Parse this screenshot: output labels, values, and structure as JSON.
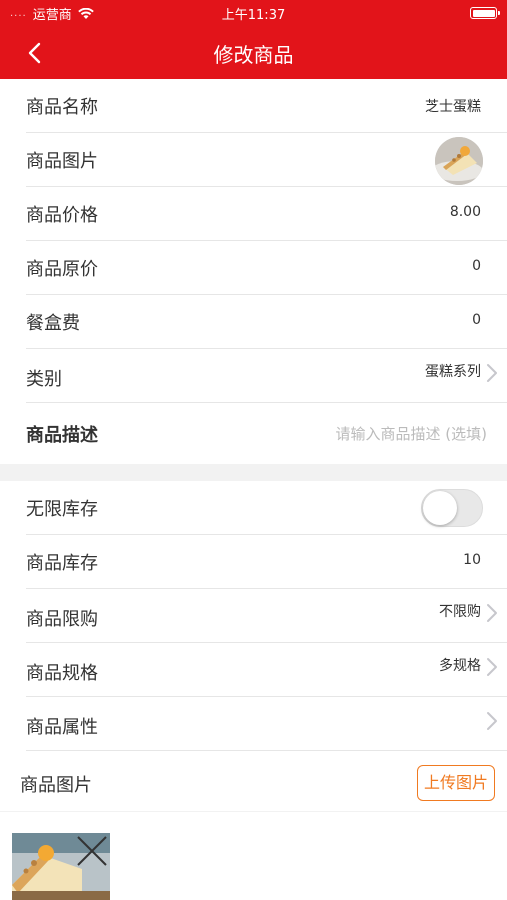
{
  "status_bar": {
    "carrier": "运营商",
    "signal_dots": "....",
    "time": "上午11:37"
  },
  "nav": {
    "title": "修改商品"
  },
  "form": {
    "name": {
      "label": "商品名称",
      "value": "芝士蛋糕"
    },
    "image": {
      "label": "商品图片"
    },
    "price": {
      "label": "商品价格",
      "value": "8.00"
    },
    "original_price": {
      "label": "商品原价",
      "value": "0"
    },
    "box_fee": {
      "label": "餐盒费",
      "value": "0"
    },
    "category": {
      "label": "类别",
      "value": "蛋糕系列"
    },
    "description": {
      "label": "商品描述",
      "placeholder": "请输入商品描述 (选填)"
    }
  },
  "stock": {
    "unlimited": {
      "label": "无限库存",
      "enabled": false
    },
    "quantity": {
      "label": "商品库存",
      "value": "10"
    },
    "purchase_limit": {
      "label": "商品限购",
      "value": "不限购"
    },
    "spec": {
      "label": "商品规格",
      "value": "多规格"
    },
    "attributes": {
      "label": "商品属性",
      "value": ""
    },
    "gallery": {
      "label": "商品图片",
      "upload_label": "上传图片"
    }
  },
  "colors": {
    "brand": "#e2141a",
    "upload_accent": "#f07a21"
  }
}
